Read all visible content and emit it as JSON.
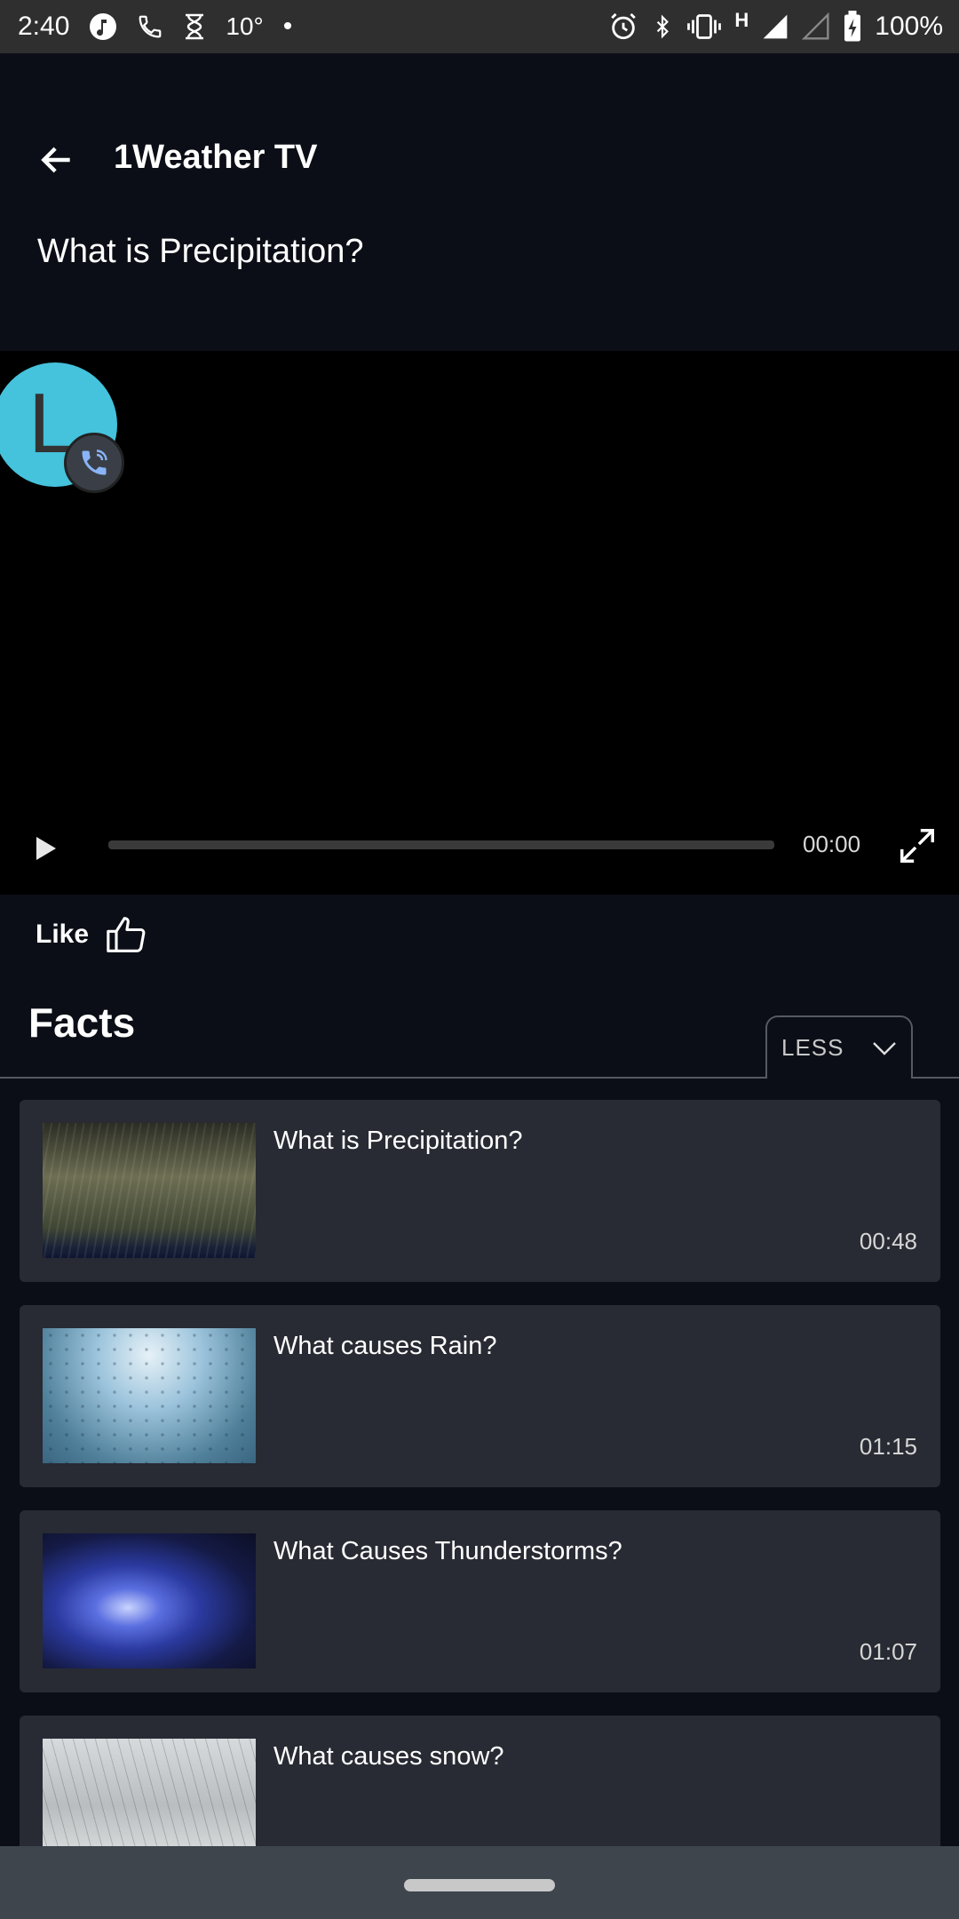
{
  "status_bar": {
    "time": "2:40",
    "temperature": "10°",
    "dot": "•",
    "network": "H",
    "battery": "100%"
  },
  "header": {
    "app_title": "1Weather TV",
    "video_title": "What is Precipitation?"
  },
  "chat_head": {
    "letter": "L",
    "color": "#45c2dc"
  },
  "player": {
    "time": "00:00",
    "progress": 0
  },
  "like": {
    "label": "Like"
  },
  "facts": {
    "title": "Facts",
    "toggle_label": "LESS",
    "items": [
      {
        "title": "What is Precipitation?",
        "duration": "00:48"
      },
      {
        "title": "What causes Rain?",
        "duration": "01:15"
      },
      {
        "title": "What Causes Thunderstorms?",
        "duration": "01:07"
      },
      {
        "title": "What causes snow?",
        "duration": ""
      }
    ]
  },
  "colors": {
    "background": "#0b0e16",
    "card": "#282b33",
    "nav_bar": "#3e454d"
  }
}
